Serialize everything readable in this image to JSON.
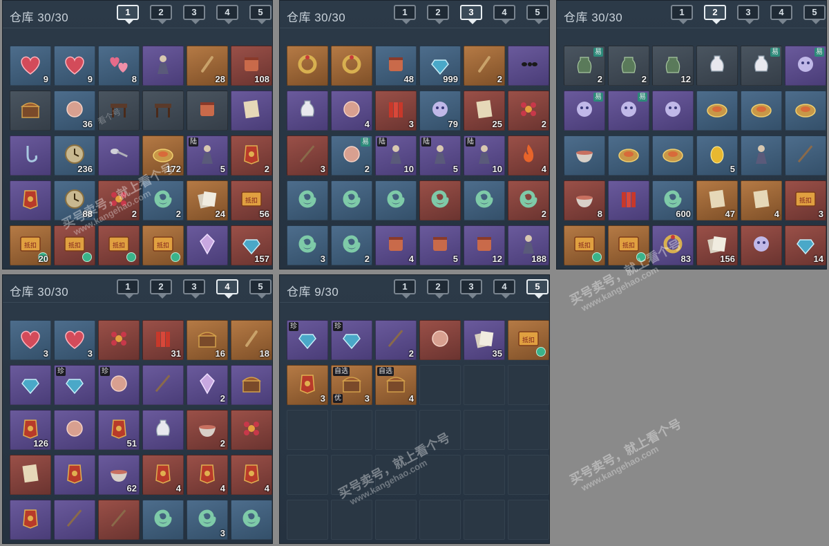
{
  "panels": [
    {
      "title": "仓库 30/30",
      "active_tab": 1,
      "tabs": [
        "1",
        "2",
        "3",
        "4",
        "5"
      ],
      "items": [
        {
          "color": "blue",
          "icon": "heart",
          "count": "9"
        },
        {
          "color": "blue",
          "icon": "heart",
          "count": "9"
        },
        {
          "color": "blue",
          "icon": "hearts",
          "count": "8"
        },
        {
          "color": "purple",
          "icon": "figure",
          "count": ""
        },
        {
          "color": "orange",
          "icon": "tool",
          "count": "28"
        },
        {
          "color": "red",
          "icon": "scroll",
          "count": "108"
        },
        {
          "color": "gray",
          "icon": "chest",
          "count": ""
        },
        {
          "color": "blue",
          "icon": "orb",
          "count": "36"
        },
        {
          "color": "gray",
          "icon": "table",
          "count": ""
        },
        {
          "color": "gray",
          "icon": "table",
          "count": ""
        },
        {
          "color": "gray",
          "icon": "scroll",
          "count": ""
        },
        {
          "color": "purple",
          "icon": "paper",
          "count": ""
        },
        {
          "color": "purple",
          "icon": "hook",
          "count": ""
        },
        {
          "color": "blue",
          "icon": "clock",
          "count": "236"
        },
        {
          "color": "purple",
          "icon": "spoon",
          "count": ""
        },
        {
          "color": "orange",
          "icon": "plate",
          "count": "172"
        },
        {
          "color": "purple",
          "icon": "figure",
          "count": "5",
          "badge": "陆"
        },
        {
          "color": "red",
          "icon": "token",
          "count": "2"
        },
        {
          "color": "purple",
          "icon": "token",
          "count": ""
        },
        {
          "color": "blue",
          "icon": "clock",
          "count": "88"
        },
        {
          "color": "red",
          "icon": "flower",
          "count": "2"
        },
        {
          "color": "blue",
          "icon": "swirl",
          "count": "2"
        },
        {
          "color": "orange",
          "icon": "cards",
          "count": "24"
        },
        {
          "color": "red",
          "icon": "coupon",
          "count": "56"
        },
        {
          "color": "orange",
          "icon": "coupon",
          "count": "20",
          "seal": true
        },
        {
          "color": "red",
          "icon": "coupon",
          "count": "",
          "seal": true
        },
        {
          "color": "red",
          "icon": "coupon",
          "count": "",
          "seal": true
        },
        {
          "color": "orange",
          "icon": "coupon",
          "count": "",
          "seal": true
        },
        {
          "color": "purple",
          "icon": "crystal",
          "count": ""
        },
        {
          "color": "red",
          "icon": "gem",
          "count": "157"
        }
      ]
    },
    {
      "title": "仓库 30/30",
      "active_tab": 3,
      "tabs": [
        "1",
        "2",
        "3",
        "4",
        "5"
      ],
      "items": [
        {
          "color": "orange",
          "icon": "ring",
          "count": ""
        },
        {
          "color": "orange",
          "icon": "ring",
          "count": ""
        },
        {
          "color": "blue",
          "icon": "scroll",
          "count": "48"
        },
        {
          "color": "blue",
          "icon": "gem",
          "count": "999"
        },
        {
          "color": "orange",
          "icon": "tool",
          "count": "2"
        },
        {
          "color": "purple",
          "icon": "ant",
          "count": ""
        },
        {
          "color": "purple",
          "icon": "vase",
          "count": ""
        },
        {
          "color": "purple",
          "icon": "orb",
          "count": "4"
        },
        {
          "color": "red",
          "icon": "bundle",
          "count": "3"
        },
        {
          "color": "blue",
          "icon": "creature",
          "count": "79"
        },
        {
          "color": "red",
          "icon": "paper",
          "count": "25"
        },
        {
          "color": "red",
          "icon": "flower",
          "count": "2"
        },
        {
          "color": "red",
          "icon": "stick",
          "count": "3"
        },
        {
          "color": "blue",
          "icon": "orb",
          "count": "2",
          "badge_right": "易"
        },
        {
          "color": "purple",
          "icon": "figure",
          "count": "10",
          "badge": "陆"
        },
        {
          "color": "purple",
          "icon": "figure",
          "count": "5",
          "badge": "陆"
        },
        {
          "color": "purple",
          "icon": "figure",
          "count": "10",
          "badge": "陆"
        },
        {
          "color": "red",
          "icon": "flame",
          "count": "4"
        },
        {
          "color": "blue",
          "icon": "swirl",
          "count": ""
        },
        {
          "color": "blue",
          "icon": "swirl",
          "count": ""
        },
        {
          "color": "blue",
          "icon": "swirl",
          "count": ""
        },
        {
          "color": "red",
          "icon": "swirl",
          "count": ""
        },
        {
          "color": "blue",
          "icon": "swirl",
          "count": ""
        },
        {
          "color": "red",
          "icon": "swirl",
          "count": "2"
        },
        {
          "color": "blue",
          "icon": "swirl",
          "count": "3"
        },
        {
          "color": "blue",
          "icon": "swirl",
          "count": "2"
        },
        {
          "color": "purple",
          "icon": "scroll",
          "count": "4"
        },
        {
          "color": "purple",
          "icon": "scroll",
          "count": "5"
        },
        {
          "color": "purple",
          "icon": "scroll",
          "count": "12"
        },
        {
          "color": "purple",
          "icon": "figure",
          "count": "188"
        }
      ]
    },
    {
      "title": "仓库 30/30",
      "active_tab": 2,
      "tabs": [
        "1",
        "2",
        "3",
        "4",
        "5"
      ],
      "items": [
        {
          "color": "gray",
          "icon": "jar",
          "count": "2",
          "badge_right": "易"
        },
        {
          "color": "gray",
          "icon": "jar",
          "count": "2"
        },
        {
          "color": "gray",
          "icon": "jar",
          "count": "12"
        },
        {
          "color": "gray",
          "icon": "vase",
          "count": ""
        },
        {
          "color": "gray",
          "icon": "vase",
          "count": "",
          "badge_right": "易"
        },
        {
          "color": "purple",
          "icon": "creature",
          "count": "",
          "badge_right": "易"
        },
        {
          "color": "purple",
          "icon": "creature",
          "count": "",
          "badge_right": "易"
        },
        {
          "color": "purple",
          "icon": "creature",
          "count": "",
          "badge_right": "易"
        },
        {
          "color": "purple",
          "icon": "creature",
          "count": ""
        },
        {
          "color": "blue",
          "icon": "plate",
          "count": ""
        },
        {
          "color": "blue",
          "icon": "plate",
          "count": ""
        },
        {
          "color": "blue",
          "icon": "plate",
          "count": ""
        },
        {
          "color": "blue",
          "icon": "bowl",
          "count": ""
        },
        {
          "color": "blue",
          "icon": "plate",
          "count": ""
        },
        {
          "color": "blue",
          "icon": "plate",
          "count": ""
        },
        {
          "color": "blue",
          "icon": "egg",
          "count": "5"
        },
        {
          "color": "blue",
          "icon": "figure",
          "count": ""
        },
        {
          "color": "blue",
          "icon": "stick",
          "count": ""
        },
        {
          "color": "red",
          "icon": "bowl",
          "count": "8"
        },
        {
          "color": "purple",
          "icon": "bundle",
          "count": ""
        },
        {
          "color": "blue",
          "icon": "swirl",
          "count": "600"
        },
        {
          "color": "orange",
          "icon": "paper",
          "count": "47"
        },
        {
          "color": "orange",
          "icon": "paper",
          "count": "4"
        },
        {
          "color": "red",
          "icon": "coupon",
          "count": "3"
        },
        {
          "color": "orange",
          "icon": "coupon",
          "count": "",
          "seal": true
        },
        {
          "color": "orange",
          "icon": "coupon",
          "count": "",
          "seal": true
        },
        {
          "color": "purple",
          "icon": "ring",
          "count": "83"
        },
        {
          "color": "red",
          "icon": "cards",
          "count": "156"
        },
        {
          "color": "red",
          "icon": "creature",
          "count": ""
        },
        {
          "color": "red",
          "icon": "gem",
          "count": "14"
        }
      ]
    },
    {
      "title": "仓库 30/30",
      "active_tab": 4,
      "tabs": [
        "1",
        "2",
        "3",
        "4",
        "5"
      ],
      "items": [
        {
          "color": "blue",
          "icon": "heart",
          "count": "3"
        },
        {
          "color": "blue",
          "icon": "heart",
          "count": "3"
        },
        {
          "color": "red",
          "icon": "flower",
          "count": ""
        },
        {
          "color": "red",
          "icon": "bundle",
          "count": "31"
        },
        {
          "color": "orange",
          "icon": "chest",
          "count": "16"
        },
        {
          "color": "orange",
          "icon": "tool",
          "count": "18"
        },
        {
          "color": "purple",
          "icon": "gem",
          "count": ""
        },
        {
          "color": "purple",
          "icon": "gem",
          "count": "",
          "badge": "珍"
        },
        {
          "color": "purple",
          "icon": "orb",
          "count": "",
          "badge": "珍"
        },
        {
          "color": "purple",
          "icon": "stick",
          "count": ""
        },
        {
          "color": "purple",
          "icon": "crystal",
          "count": "2"
        },
        {
          "color": "purple",
          "icon": "chest",
          "count": ""
        },
        {
          "color": "purple",
          "icon": "token",
          "count": "126"
        },
        {
          "color": "purple",
          "icon": "orb",
          "count": ""
        },
        {
          "color": "purple",
          "icon": "token",
          "count": "51"
        },
        {
          "color": "purple",
          "icon": "vase",
          "count": ""
        },
        {
          "color": "red",
          "icon": "bowl",
          "count": "2"
        },
        {
          "color": "red",
          "icon": "flower",
          "count": ""
        },
        {
          "color": "red",
          "icon": "paper",
          "count": ""
        },
        {
          "color": "purple",
          "icon": "token",
          "count": ""
        },
        {
          "color": "purple",
          "icon": "bowl",
          "count": "62"
        },
        {
          "color": "red",
          "icon": "token",
          "count": "4"
        },
        {
          "color": "red",
          "icon": "token",
          "count": "4"
        },
        {
          "color": "red",
          "icon": "token",
          "count": "4"
        },
        {
          "color": "purple",
          "icon": "token",
          "count": ""
        },
        {
          "color": "purple",
          "icon": "stick",
          "count": ""
        },
        {
          "color": "red",
          "icon": "stick",
          "count": ""
        },
        {
          "color": "blue",
          "icon": "swirl",
          "count": ""
        },
        {
          "color": "blue",
          "icon": "swirl",
          "count": "3"
        },
        {
          "color": "blue",
          "icon": "swirl",
          "count": ""
        }
      ]
    },
    {
      "title": "仓库 9/30",
      "active_tab": 5,
      "tabs": [
        "1",
        "2",
        "3",
        "4",
        "5"
      ],
      "items": [
        {
          "color": "purple",
          "icon": "gem",
          "count": "",
          "badge": "珍"
        },
        {
          "color": "purple",
          "icon": "gem",
          "count": "",
          "badge": "珍"
        },
        {
          "color": "purple",
          "icon": "stick",
          "count": "2"
        },
        {
          "color": "red",
          "icon": "orb",
          "count": ""
        },
        {
          "color": "purple",
          "icon": "cards",
          "count": "35"
        },
        {
          "color": "orange",
          "icon": "coupon",
          "count": "",
          "seal": true
        },
        {
          "color": "orange",
          "icon": "token",
          "count": "3"
        },
        {
          "color": "orange",
          "icon": "chest",
          "count": "3",
          "badge": "自选",
          "badge2": "优"
        },
        {
          "color": "orange",
          "icon": "chest",
          "count": "4",
          "badge": "自选"
        }
      ]
    }
  ],
  "watermark": {
    "line1": "买号卖号，就上看个号",
    "line2": "www.kangehao.com",
    "brand": "看个号"
  }
}
